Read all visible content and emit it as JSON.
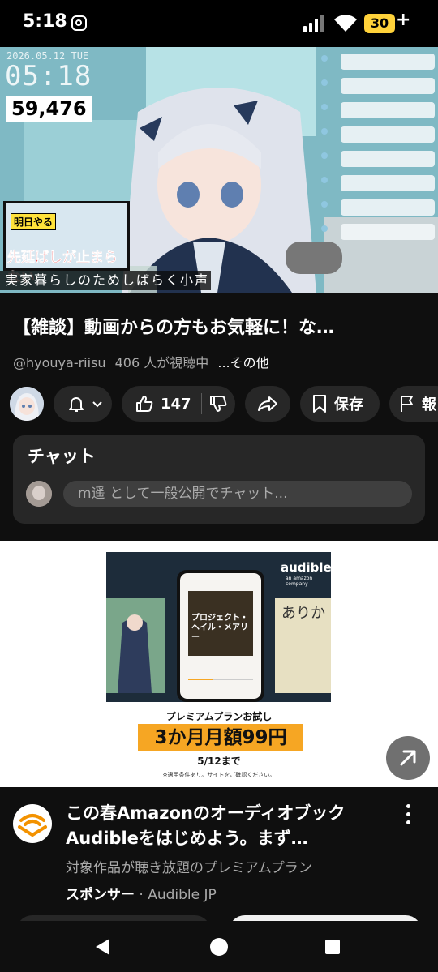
{
  "status_bar": {
    "time": "5:18",
    "battery": "30",
    "battery_plus": "+"
  },
  "video": {
    "date_overlay": "2026.05.12 TUE",
    "clock_overlay": "05:18",
    "counter_overlay": "59,476",
    "thumb_label_1": "明日やる",
    "thumb_label_2": "先延ばしが止まらない",
    "subtitle": "実家暮らしのためしばらく小声"
  },
  "title": "【雑談】動画からの方もお気軽に！な…",
  "meta": {
    "handle": "@hyouya-riisu",
    "viewers": "406 人が視聴中",
    "more": "...その他"
  },
  "actions": {
    "like_count": "147",
    "save_label": "保存",
    "report_label": "報"
  },
  "chat": {
    "title": "チャット",
    "placeholder": "m遥 として一般公開でチャット..."
  },
  "ad": {
    "brand": "audible",
    "brand_sub": "an amazon company",
    "phone_cover_text": "プロジェクト・ヘイル・メアリー",
    "right_book_text": "ありか",
    "line1": "プレミアムプランお試し",
    "line2": "3か月月額99円",
    "line3": "5/12まで",
    "line4": "※適用条件あり。サイトをご確認ください。"
  },
  "sponsored": {
    "title": "この春Amazonのオーディオブック Audibleをはじめよう。まず…",
    "description": "対象作品が聴き放題のプレミアムプラン",
    "label": "スポンサー",
    "separator": " · ",
    "advertiser": "Audible JP"
  },
  "colors": {
    "background": "#0f0f0f",
    "surface": "#272727",
    "secondary_text": "#aaaaaa",
    "battery": "#ffd23a",
    "ad_orange": "#f6a623"
  }
}
